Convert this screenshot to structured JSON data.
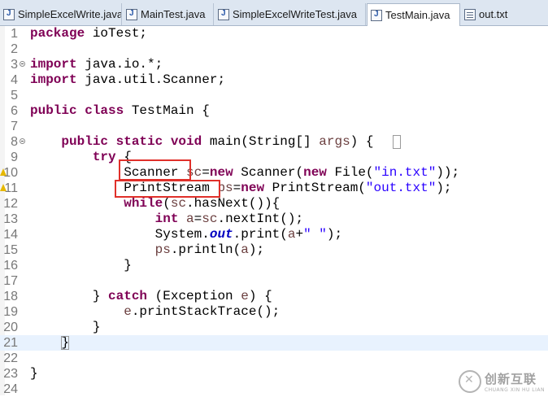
{
  "tabs": [
    {
      "label": "SimpleExcelWrite.java",
      "icon": "java-file-icon",
      "active": false
    },
    {
      "label": "MainTest.java",
      "icon": "java-file-icon",
      "active": false
    },
    {
      "label": "SimpleExcelWriteTest.java",
      "icon": "java-file-icon",
      "active": false
    },
    {
      "label": "TestMain.java",
      "icon": "java-file-icon",
      "active": true
    },
    {
      "label": "out.txt",
      "icon": "text-file-icon",
      "active": false
    }
  ],
  "line_numbers": [
    "1",
    "2",
    "3",
    "4",
    "5",
    "6",
    "7",
    "8",
    "9",
    "10",
    "11",
    "12",
    "13",
    "14",
    "15",
    "16",
    "17",
    "18",
    "19",
    "20",
    "21",
    "22",
    "23",
    "24"
  ],
  "code": {
    "l1_kw": "package",
    "l1_rest": " ioTest;",
    "l3_kw": "import",
    "l3_rest": " java.io.*;",
    "l4_kw": "import",
    "l4_rest": " java.util.Scanner;",
    "l6_kw": "public class",
    "l6_rest": " TestMain {",
    "l8_kw": "public static void",
    "l8_a": " main(String[] ",
    "l8_var": "args",
    "l8_b": ") {",
    "l9_kw": "try",
    "l9_rest": " {",
    "l10_type": "Scanner",
    "l10_a": " ",
    "l10_var": "sc",
    "l10_b": "=",
    "l10_kw": "new",
    "l10_c": " Scanner(",
    "l10_kw2": "new",
    "l10_d": " File(",
    "l10_str": "\"in.txt\"",
    "l10_e": "));",
    "l11_type": "PrintStream",
    "l11_a": " ",
    "l11_var": "ps",
    "l11_b": "=",
    "l11_kw": "new",
    "l11_c": " PrintStream(",
    "l11_str": "\"out.txt\"",
    "l11_d": ");",
    "l12_kw": "while",
    "l12_a": "(",
    "l12_var": "sc",
    "l12_b": ".hasNext()){",
    "l13_kw": "int",
    "l13_a": " ",
    "l13_var": "a",
    "l13_b": "=",
    "l13_var2": "sc",
    "l13_c": ".nextInt();",
    "l14_a": "System.",
    "l14_fld": "out",
    "l14_b": ".print(",
    "l14_var": "a",
    "l14_c": "+",
    "l14_str": "\" \"",
    "l14_d": ");",
    "l15_var": "ps",
    "l15_a": ".println(",
    "l15_var2": "a",
    "l15_b": ");",
    "l16": "}",
    "l18_a": "} ",
    "l18_kw": "catch",
    "l18_b": " (Exception ",
    "l18_var": "e",
    "l18_c": ") {",
    "l19_var": "e",
    "l19_a": ".printStackTrace();",
    "l20": "}",
    "l21": "}",
    "l23": "}"
  },
  "warnings": [
    "10",
    "11"
  ],
  "watermark": {
    "text_cn": "创新互联",
    "text_en": "CHUANG XIN HU LIAN"
  }
}
